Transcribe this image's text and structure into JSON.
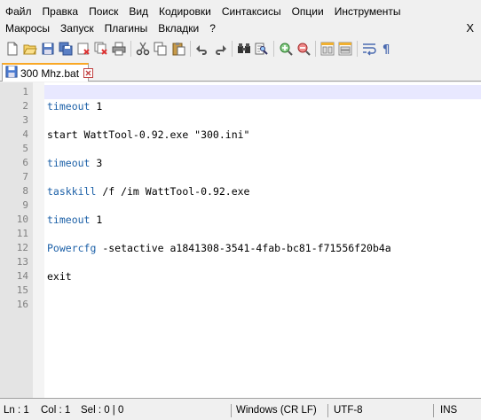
{
  "menu": {
    "row1": [
      "Файл",
      "Правка",
      "Поиск",
      "Вид",
      "Кодировки",
      "Синтаксисы",
      "Опции",
      "Инструменты"
    ],
    "row2": [
      "Макросы",
      "Запуск",
      "Плагины",
      "Вкладки",
      "?"
    ],
    "close": "X"
  },
  "toolbar": {
    "icons": [
      "new-file-icon",
      "open-file-icon",
      "save-icon",
      "save-all-icon",
      "close-icon",
      "close-all-icon",
      "print-icon",
      "cut-icon",
      "copy-icon",
      "paste-icon",
      "undo-icon",
      "redo-icon",
      "find-icon",
      "replace-icon",
      "zoom-in-icon",
      "zoom-out-icon",
      "sync-vertical-icon",
      "sync-horizontal-icon",
      "word-wrap-icon",
      "show-all-chars-icon"
    ]
  },
  "tab": {
    "label": "300 Mhz.bat"
  },
  "editor": {
    "lines": [
      {
        "n": "1",
        "text": ""
      },
      {
        "n": "2",
        "text": "timeout 1"
      },
      {
        "n": "3",
        "text": ""
      },
      {
        "n": "4",
        "text": "start WattTool-0.92.exe \"300.ini\""
      },
      {
        "n": "5",
        "text": ""
      },
      {
        "n": "6",
        "text": "timeout 3"
      },
      {
        "n": "7",
        "text": ""
      },
      {
        "n": "8",
        "text": "taskkill /f /im WattTool-0.92.exe"
      },
      {
        "n": "9",
        "text": ""
      },
      {
        "n": "10",
        "text": "timeout 1"
      },
      {
        "n": "11",
        "text": ""
      },
      {
        "n": "12",
        "text": "Powercfg -setactive a1841308-3541-4fab-bc81-f71556f20b4a"
      },
      {
        "n": "13",
        "text": ""
      },
      {
        "n": "14",
        "text": "exit"
      },
      {
        "n": "15",
        "text": ""
      },
      {
        "n": "16",
        "text": ""
      }
    ]
  },
  "status": {
    "ln": "Ln : 1",
    "col": "Col : 1",
    "sel": "Sel : 0 | 0",
    "eol": "Windows (CR LF)",
    "encoding": "UTF-8",
    "mode": "INS"
  }
}
